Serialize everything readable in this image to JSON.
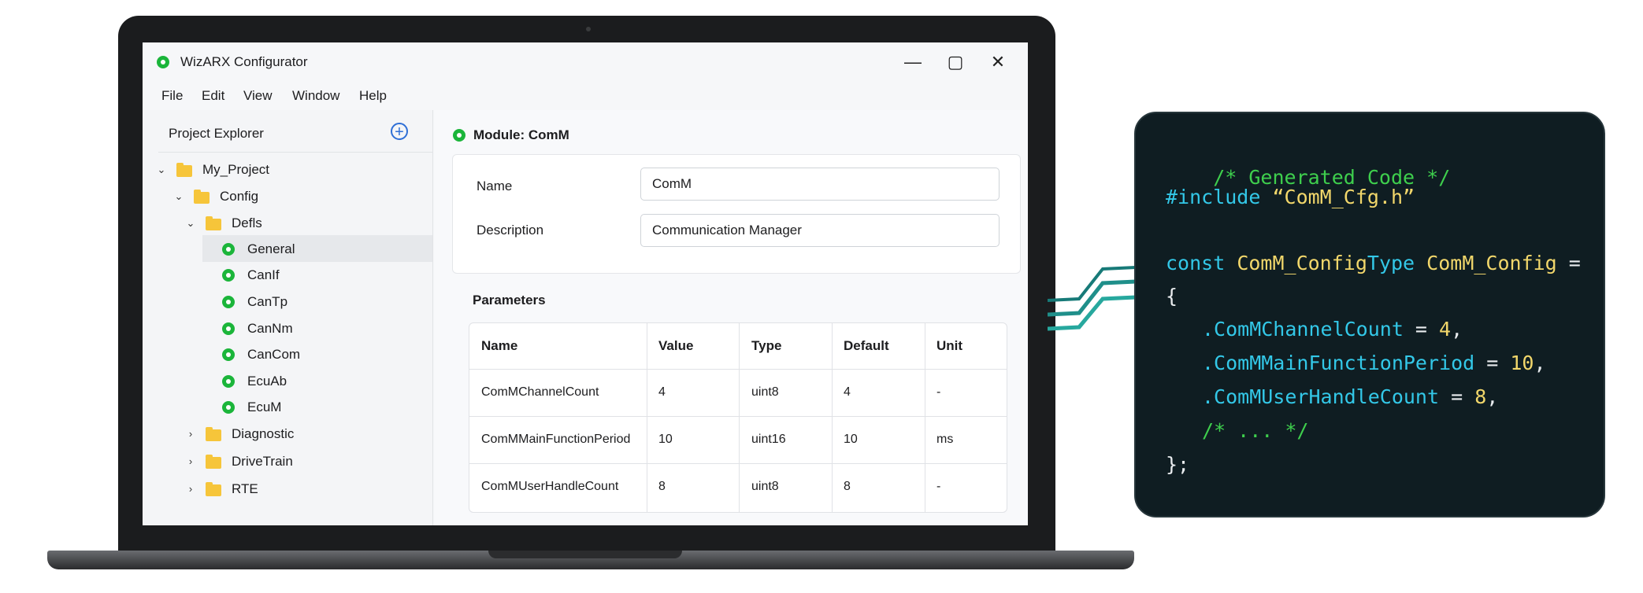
{
  "window": {
    "title": "WizARX Configurator",
    "minimize": "—",
    "maximize": "▢",
    "close": "✕"
  },
  "menu": [
    "File",
    "Edit",
    "View",
    "Window",
    "Help"
  ],
  "explorer": {
    "title": "Project Explorer",
    "tree": [
      {
        "label": "My_Project",
        "kind": "folder",
        "expanded": true
      },
      {
        "label": "Config",
        "kind": "folder",
        "expanded": true
      },
      {
        "label": "Defls",
        "kind": "folder",
        "expanded": true
      },
      {
        "label": "General",
        "kind": "module",
        "selected": true
      },
      {
        "label": "CanIf",
        "kind": "module"
      },
      {
        "label": "CanTp",
        "kind": "module"
      },
      {
        "label": "CanNm",
        "kind": "module"
      },
      {
        "label": "CanCom",
        "kind": "module"
      },
      {
        "label": "EcuAb",
        "kind": "module"
      },
      {
        "label": "EcuM",
        "kind": "module"
      },
      {
        "label": "Diagnostic",
        "kind": "folder",
        "expanded": false
      },
      {
        "label": "DriveTrain",
        "kind": "folder",
        "expanded": false
      },
      {
        "label": "RTE",
        "kind": "folder",
        "expanded": false
      }
    ]
  },
  "module": {
    "title": "Module: ComM",
    "name_label": "Name",
    "name_value": "ComM",
    "description_label": "Description",
    "description_value": "Communication Manager"
  },
  "parameters": {
    "title": "Parameters",
    "columns": [
      "Name",
      "Value",
      "Type",
      "Default",
      "Unit"
    ],
    "rows": [
      [
        "ComMChannelCount",
        "4",
        "uint8",
        "4",
        "-"
      ],
      [
        "ComMMainFunctionPeriod",
        "10",
        "uint16",
        "10",
        "ms"
      ],
      [
        "ComMUserHandleCount",
        "8",
        "uint8",
        "8",
        "-"
      ]
    ]
  },
  "code": {
    "comment": "/* Generated Code */",
    "include_kw": "#include",
    "include_file": " “ComM_Cfg.h”",
    "const_kw": "const",
    "type_a": " ComM_Config",
    "type_b": "Type",
    "var_name": " ComM_Config",
    "assign": " =",
    "open_brace": "{",
    "fields": [
      {
        "name": ".ComMChannelCount",
        "eq": " = ",
        "value": "4",
        "end": ","
      },
      {
        "name": ".ComMMainFunctionPeriod",
        "eq": " = ",
        "value": "10",
        "end": ","
      },
      {
        "name": ".ComMUserHandleCount",
        "eq": " = ",
        "value": "8",
        "end": ","
      }
    ],
    "ellipsis": "/* ... */",
    "close": "};"
  },
  "colors": {
    "status_green": "#1bb53a",
    "accent_blue": "#2f6fd6",
    "code_bg": "#0f1d22"
  }
}
